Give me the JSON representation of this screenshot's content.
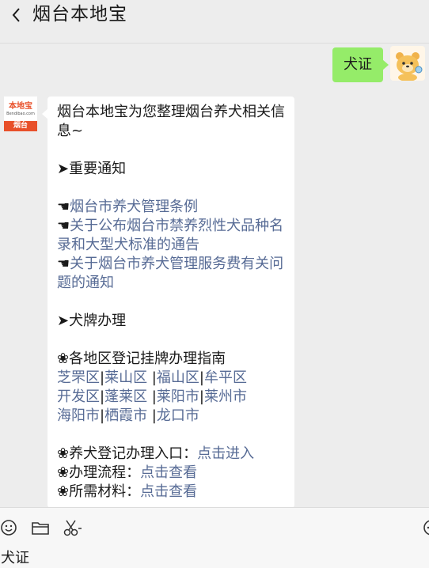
{
  "header": {
    "title": "烟台本地宝"
  },
  "user_message": {
    "text": "犬证"
  },
  "bot": {
    "brand": "本地宝",
    "brand_url": "Bendibao.com",
    "city": "烟台",
    "message": {
      "intro_1": "烟台本地宝为您整理烟台养犬相关信",
      "intro_2": "息~",
      "section1": "➤重要通知",
      "notice1": "烟台市养犬管理条例",
      "notice2_a": "关于公布烟台市禁养烈性犬品种名",
      "notice2_b": "录和大型犬标准的通告",
      "notice3_a": "关于烟台市养犬管理服务费有关问",
      "notice3_b": "题的通知",
      "section2": "➤犬牌办理",
      "guide": "❀各地区登记挂牌办理指南",
      "districts_row1": [
        "芝罘区",
        "莱山区",
        "福山区",
        "牟平区"
      ],
      "districts_row2": [
        "开发区",
        "蓬莱区",
        "莱阳市",
        "莱州市"
      ],
      "districts_row3": [
        "海阳市",
        "栖霞市",
        "龙口市"
      ],
      "entry_label": "❀养犬登记办理入口：",
      "entry_link": "点击进入",
      "process_label": "❀办理流程：",
      "process_link": "点击查看",
      "materials_label": "❀所需材料：",
      "materials_link": "点击查看"
    }
  },
  "input": {
    "value": "犬证"
  }
}
